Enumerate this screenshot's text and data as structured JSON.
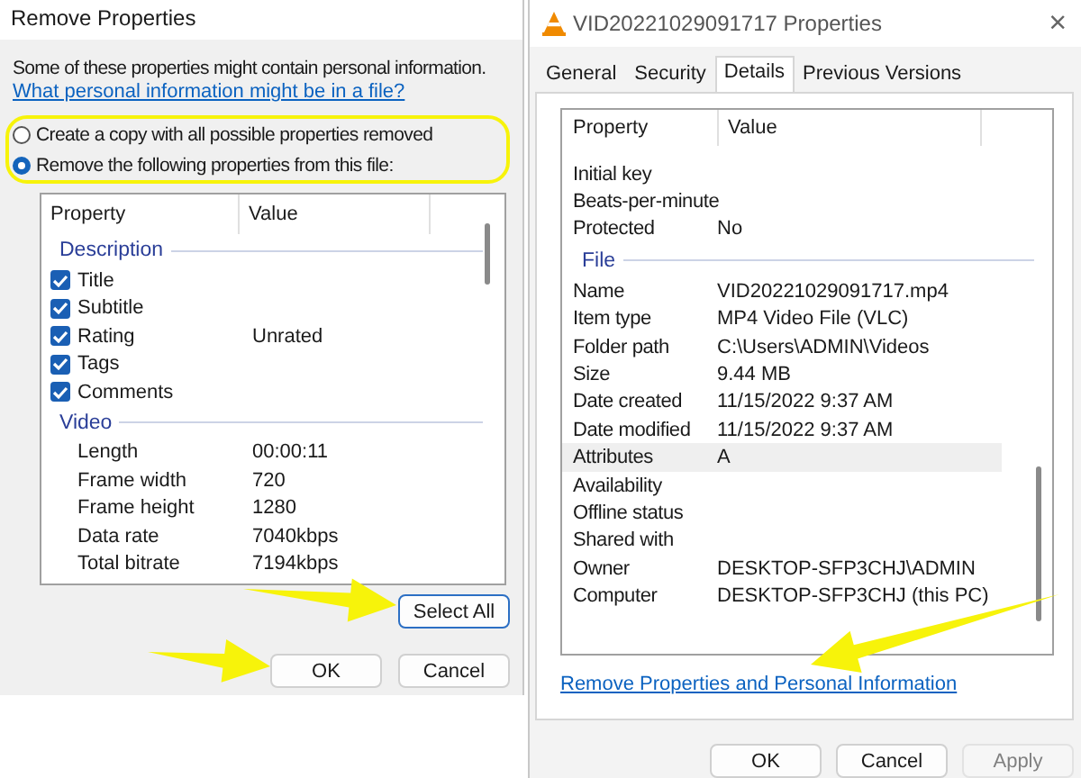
{
  "left_dialog": {
    "title": "Remove Properties",
    "intro": "Some of these properties might contain personal information.",
    "link": "What personal information might be in a file?",
    "options": [
      {
        "label": "Create a copy with all possible properties removed",
        "selected": false
      },
      {
        "label": "Remove the following properties from this file:",
        "selected": true
      }
    ],
    "columns": [
      "Property",
      "Value"
    ],
    "groups": [
      {
        "name": "Description",
        "items": [
          {
            "kind": "check",
            "property": "Title",
            "value": "",
            "checked": true
          },
          {
            "kind": "check",
            "property": "Subtitle",
            "value": "",
            "checked": true
          },
          {
            "kind": "check",
            "property": "Rating",
            "value": "Unrated",
            "checked": true
          },
          {
            "kind": "check",
            "property": "Tags",
            "value": "",
            "checked": true
          },
          {
            "kind": "check",
            "property": "Comments",
            "value": "",
            "checked": true
          }
        ]
      },
      {
        "name": "Video",
        "items": [
          {
            "kind": "plain",
            "property": "Length",
            "value": "00:00:11"
          },
          {
            "kind": "plain",
            "property": "Frame width",
            "value": "720"
          },
          {
            "kind": "plain",
            "property": "Frame height",
            "value": "1280"
          },
          {
            "kind": "plain",
            "property": "Data rate",
            "value": "7040kbps"
          },
          {
            "kind": "plain",
            "property": "Total bitrate",
            "value": "7194kbps"
          }
        ]
      }
    ],
    "select_all": "Select All",
    "buttons": [
      "OK",
      "Cancel"
    ]
  },
  "right_dialog": {
    "title": "VID20221029091717 Properties",
    "close": "×",
    "tabs": [
      {
        "label": "General",
        "selected": false
      },
      {
        "label": "Security",
        "selected": false
      },
      {
        "label": "Details",
        "selected": true
      },
      {
        "label": "Previous Versions",
        "selected": false
      }
    ],
    "columns": [
      "Property",
      "Value"
    ],
    "rows": [
      {
        "kind": "row",
        "property": "Initial key",
        "value": "",
        "selected": false
      },
      {
        "kind": "row",
        "property": "Beats-per-minute",
        "value": "",
        "selected": false
      },
      {
        "kind": "row",
        "property": "Protected",
        "value": "No",
        "selected": false
      },
      {
        "kind": "group",
        "property": "File",
        "value": "",
        "selected": false
      },
      {
        "kind": "row",
        "property": "Name",
        "value": "VID20221029091717.mp4",
        "selected": false
      },
      {
        "kind": "row",
        "property": "Item type",
        "value": "MP4 Video File (VLC)",
        "selected": false
      },
      {
        "kind": "row",
        "property": "Folder path",
        "value": "C:\\Users\\ADMIN\\Videos",
        "selected": false
      },
      {
        "kind": "row",
        "property": "Size",
        "value": "9.44 MB",
        "selected": false
      },
      {
        "kind": "row",
        "property": "Date created",
        "value": "11/15/2022 9:37 AM",
        "selected": false
      },
      {
        "kind": "row",
        "property": "Date modified",
        "value": "11/15/2022 9:37 AM",
        "selected": false
      },
      {
        "kind": "row",
        "property": "Attributes",
        "value": "A",
        "selected": true
      },
      {
        "kind": "row",
        "property": "Availability",
        "value": "",
        "selected": false
      },
      {
        "kind": "row",
        "property": "Offline status",
        "value": "",
        "selected": false
      },
      {
        "kind": "row",
        "property": "Shared with",
        "value": "",
        "selected": false
      },
      {
        "kind": "row",
        "property": "Owner",
        "value": "DESKTOP-SFP3CHJ\\ADMIN",
        "selected": false
      },
      {
        "kind": "row",
        "property": "Computer",
        "value": "DESKTOP-SFP3CHJ (this PC)",
        "selected": false
      }
    ],
    "link": "Remove Properties and Personal Information",
    "buttons": [
      {
        "label": "OK",
        "disabled": false
      },
      {
        "label": "Cancel",
        "disabled": false
      },
      {
        "label": "Apply",
        "disabled": true
      }
    ]
  }
}
